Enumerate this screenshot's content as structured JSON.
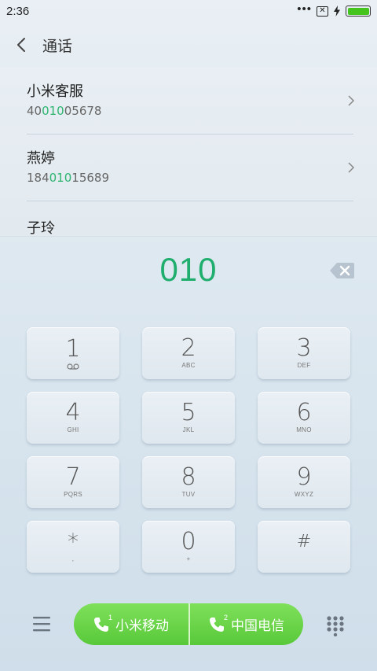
{
  "status_bar": {
    "time": "2:36",
    "more_dots": "•••"
  },
  "header": {
    "title": "通话"
  },
  "contacts": [
    {
      "name": "小米客服",
      "number_pre": "40",
      "number_match": "010",
      "number_post": "05678"
    },
    {
      "name": "燕婷",
      "number_pre": "184",
      "number_match": "010",
      "number_post": "15689"
    },
    {
      "name": "子玲",
      "number_pre": "",
      "number_match": "",
      "number_post": ""
    }
  ],
  "dialer": {
    "input": "010"
  },
  "keypad": [
    {
      "digit": "1",
      "letters": ""
    },
    {
      "digit": "2",
      "letters": "ABC"
    },
    {
      "digit": "3",
      "letters": "DEF"
    },
    {
      "digit": "4",
      "letters": "GHI"
    },
    {
      "digit": "5",
      "letters": "JKL"
    },
    {
      "digit": "6",
      "letters": "MNO"
    },
    {
      "digit": "7",
      "letters": "PQRS"
    },
    {
      "digit": "8",
      "letters": "TUV"
    },
    {
      "digit": "9",
      "letters": "WXYZ"
    },
    {
      "digit": "*",
      "letters": ","
    },
    {
      "digit": "0",
      "letters": "+"
    },
    {
      "digit": "#",
      "letters": ""
    }
  ],
  "call_buttons": [
    {
      "sim": "1",
      "label": "小米移动"
    },
    {
      "sim": "2",
      "label": "中国电信"
    }
  ],
  "colors": {
    "match_highlight": "#2db570",
    "call_green": "#58c93a",
    "battery_green": "#46c41e"
  }
}
